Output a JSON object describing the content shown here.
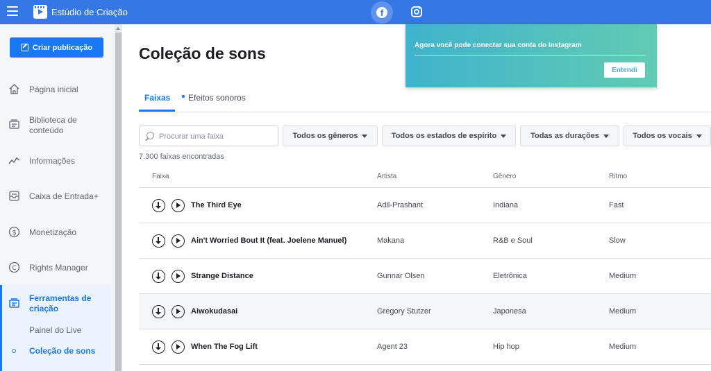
{
  "topbar": {
    "app_title": "Estúdio de Criação",
    "menu_icon": "hamburger-icon",
    "logo_icon": "clapperboard-icon",
    "platform_tabs": [
      {
        "name": "facebook",
        "icon": "facebook-icon",
        "active": true
      },
      {
        "name": "instagram",
        "icon": "instagram-icon",
        "active": false
      }
    ],
    "color": "#3578e5"
  },
  "sidebar": {
    "create_button": "Criar publicação",
    "items": [
      {
        "label": "Página inicial",
        "icon": "home-icon"
      },
      {
        "label": "Biblioteca de conteúdo",
        "icon": "library-icon"
      },
      {
        "label": "Informações",
        "icon": "insights-icon"
      },
      {
        "label": "Caixa de Entrada+",
        "icon": "inbox-icon"
      },
      {
        "label": "Monetização",
        "icon": "dollar-icon"
      },
      {
        "label": "Rights Manager",
        "icon": "copyright-icon"
      },
      {
        "label": "Ferramentas de criação",
        "icon": "tools-icon",
        "active": true
      }
    ],
    "subitems": [
      {
        "label": "Painel do Live"
      },
      {
        "label": "Coleção de sons",
        "current": true
      }
    ]
  },
  "main": {
    "title": "Coleção de sons",
    "tabs": [
      {
        "label": "Faixas",
        "selected": true
      },
      {
        "label": "Efeitos sonoros",
        "selected": false
      }
    ],
    "search": {
      "placeholder": "Procurar uma faixa",
      "value": ""
    },
    "filters": [
      {
        "label": "Todos os gêneros"
      },
      {
        "label": "Todos os estados de espírito"
      },
      {
        "label": "Todas as durações"
      },
      {
        "label": "Todos os vocais"
      }
    ],
    "count": "7.300 faixas encontradas",
    "columns": [
      "Faixa",
      "Artista",
      "Gênero",
      "Ritmo"
    ],
    "rows": [
      {
        "track": "The Third Eye",
        "artist": "Adil-Prashant",
        "genre": "Indiana",
        "tempo": "Fast"
      },
      {
        "track": "Ain't Worried Bout It (feat. Joelene Manuel)",
        "artist": "Makana",
        "genre": "R&B e Soul",
        "tempo": "Slow"
      },
      {
        "track": "Strange Distance",
        "artist": "Gunnar Olsen",
        "genre": "Eletrônica",
        "tempo": "Medium"
      },
      {
        "track": "Aiwokudasai",
        "artist": "Gregory Stutzer",
        "genre": "Japonesa",
        "tempo": "Medium"
      },
      {
        "track": "When The Fog Lift",
        "artist": "Agent 23",
        "genre": "Hip hop",
        "tempo": "Medium"
      }
    ]
  },
  "popup": {
    "message": "Agora você pode conectar sua conta do Instagram",
    "button": "Entendi"
  }
}
